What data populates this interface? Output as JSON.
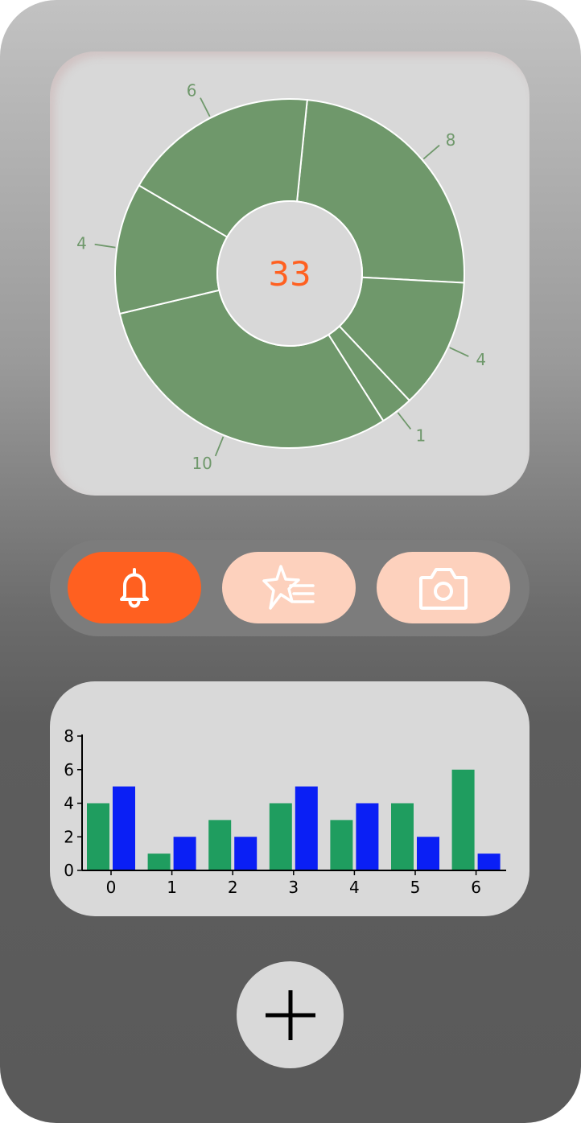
{
  "colors": {
    "accent": "#ff6020",
    "accent_soft": "#fdd1bd",
    "donut_fill": "#6f986b",
    "donut_text": "#6f986b",
    "center_text": "#ff6020",
    "series_green": "#1f9d5f",
    "series_blue": "#0a1ff5"
  },
  "donut": {
    "center_value": "33",
    "segments": [
      {
        "value": 8,
        "label": "8"
      },
      {
        "value": 4,
        "label": "4"
      },
      {
        "value": 1,
        "label": "1"
      },
      {
        "value": 10,
        "label": "10"
      },
      {
        "value": 4,
        "label": "4"
      },
      {
        "value": 6,
        "label": "6"
      }
    ]
  },
  "actions": [
    {
      "name": "notifications",
      "icon": "bell-icon",
      "active": true
    },
    {
      "name": "favorites",
      "icon": "star-list-icon",
      "active": false
    },
    {
      "name": "camera",
      "icon": "camera-icon",
      "active": false
    }
  ],
  "fab": {
    "icon": "plus-icon"
  },
  "chart_data": {
    "type": "bar",
    "categories": [
      "0",
      "1",
      "2",
      "3",
      "4",
      "5",
      "6"
    ],
    "series": [
      {
        "values": [
          4,
          1,
          3,
          4,
          3,
          4,
          6
        ]
      },
      {
        "values": [
          5,
          2,
          2,
          5,
          4,
          2,
          1
        ]
      }
    ],
    "ylim": [
      0,
      8
    ],
    "yticks": [
      "0",
      "2",
      "4",
      "6",
      "8"
    ],
    "grid": false
  }
}
